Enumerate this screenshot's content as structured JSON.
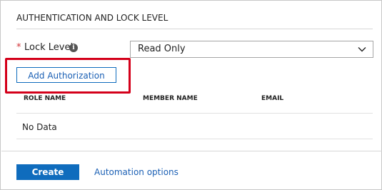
{
  "section": {
    "title": "AUTHENTICATION AND LOCK LEVEL"
  },
  "lock_level": {
    "required_marker": "*",
    "label": "Lock Level",
    "info_icon": "info-icon",
    "info_glyph": "i",
    "selected_value": "Read Only",
    "dropdown_icon": "chevron-down-icon"
  },
  "actions": {
    "add_authorization_label": "Add Authorization"
  },
  "table": {
    "columns": [
      "ROLE NAME",
      "MEMBER NAME",
      "EMAIL"
    ],
    "empty_text": "No Data"
  },
  "footer": {
    "create_label": "Create",
    "automation_link_label": "Automation options"
  },
  "colors": {
    "accent": "#0f6cbd",
    "highlight": "#d4001a",
    "required": "#d13438"
  }
}
